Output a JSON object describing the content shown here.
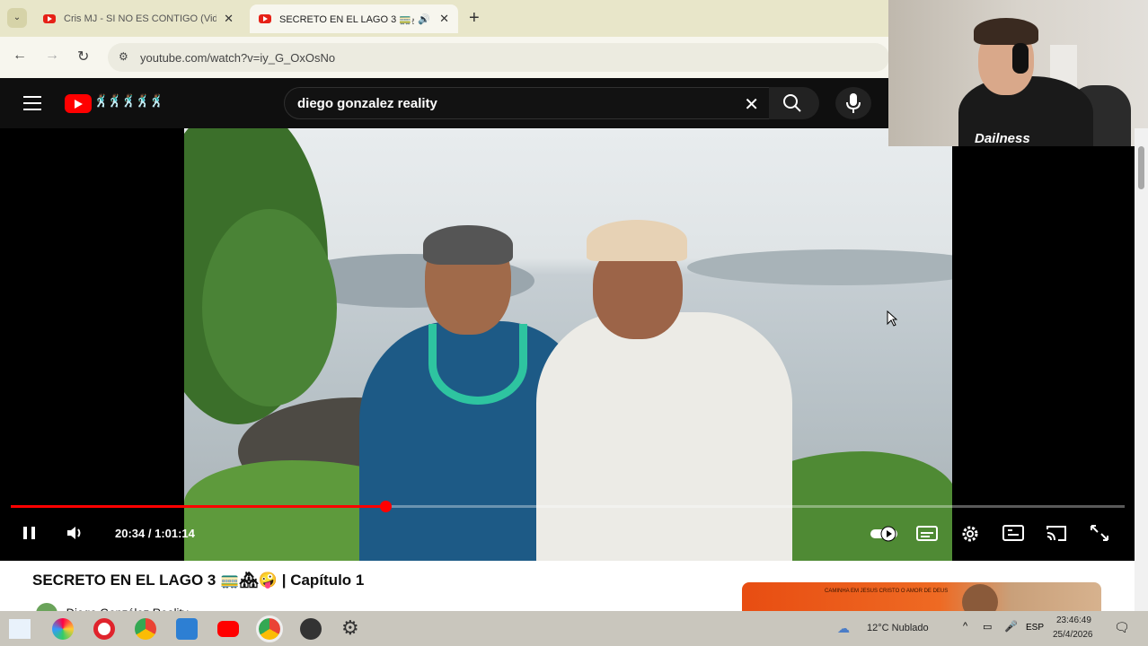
{
  "browser": {
    "tabs": [
      {
        "title": "Cris MJ - SI NO ES CONTIGO (Vid",
        "active": false
      },
      {
        "title": "SECRETO EN EL LAGO 3 🚃🏘",
        "active": true
      }
    ],
    "url": "youtube.com/watch?v=iy_G_OxOsNo"
  },
  "youtube": {
    "search_query": "diego gonzalez reality",
    "logo_emoji": "🕺🏾🕺🏾🕺🏾🕺🏾🕺🏾"
  },
  "player": {
    "current_time": "20:34",
    "duration": "1:01:14",
    "time_label": "20:34 / 1:01:14",
    "progress": 0.336
  },
  "video": {
    "title": "SECRETO EN EL LAGO 3 🚃🏘🤪 | Capítulo 1",
    "channel": "Diego González Reality"
  },
  "webcam": {
    "shirt_text": "Dailness"
  },
  "ad": {
    "text": "CAMINHA EM JESUS CRISTO O AMOR DE DEUS"
  },
  "taskbar": {
    "weather": "12°C Nublado",
    "language": "ESP",
    "time": "23:46:49",
    "date": "25/4/2026"
  },
  "colors": {
    "youtube_red": "#ff0000",
    "header_bg": "#0f0f0f",
    "tabstrip_bg": "#e8e6c9"
  }
}
